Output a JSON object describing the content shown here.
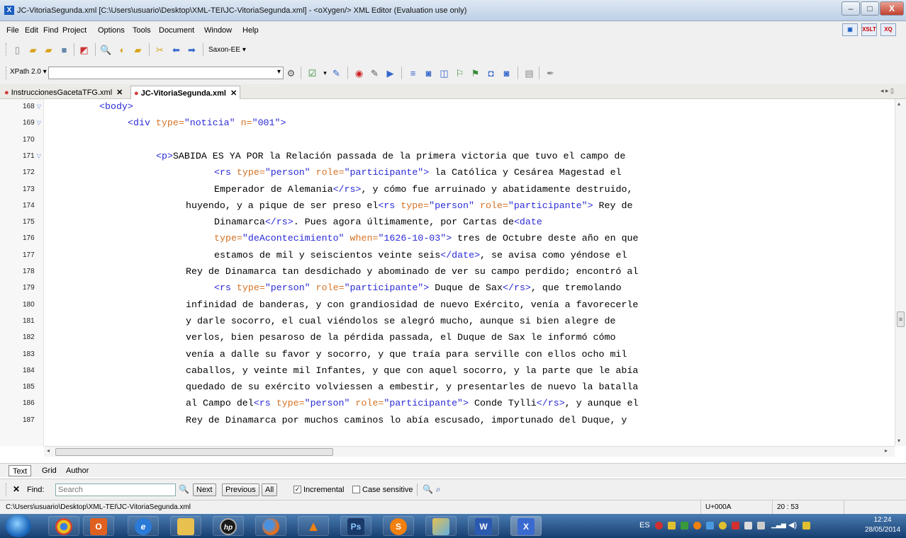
{
  "window": {
    "title": "JC-VitoriaSegunda.xml [C:\\Users\\usuario\\Desktop\\XML-TEI\\JC-VitoriaSegunda.xml] - <oXygen/> XML Editor (Evaluation use only)",
    "controls": {
      "minimize": "–",
      "maximize": "□",
      "close": "X"
    }
  },
  "menu": [
    "File",
    "Edit",
    "Find",
    "Project",
    "Options",
    "Tools",
    "Document",
    "Window",
    "Help"
  ],
  "perspective_buttons": {
    "xslt": "XSLT",
    "xquery": "XQ"
  },
  "toolbar": {
    "transformer": "Saxon-EE",
    "xpath_version": "XPath 2.0",
    "xpath_value": ""
  },
  "tabs": [
    {
      "label": "InstruccionesGacetaTFG.xml",
      "modified": true,
      "active": false
    },
    {
      "label": "JC-VitoriaSegunda.xml",
      "modified": true,
      "active": true
    }
  ],
  "editor": {
    "lines": [
      {
        "n": "168",
        "fold": true,
        "segments": [
          {
            "t": "tag",
            "v": "<body>"
          }
        ]
      },
      {
        "n": "169",
        "fold": true,
        "segments": [
          {
            "t": "tag",
            "v": "<div "
          },
          {
            "t": "attr",
            "v": "type="
          },
          {
            "t": "val",
            "v": "\"noticia\""
          },
          {
            "t": "attr",
            "v": " n="
          },
          {
            "t": "val",
            "v": "\"001\""
          },
          {
            "t": "tag",
            "v": ">"
          }
        ]
      },
      {
        "n": "170",
        "fold": false,
        "segments": []
      },
      {
        "n": "171",
        "fold": true,
        "segments": [
          {
            "t": "tag",
            "v": "<p>"
          },
          {
            "t": "txt",
            "v": "SABIDA ES YA POR la Relación passada de la primera victoria que tuvo el campo de"
          }
        ]
      },
      {
        "n": "172",
        "fold": false,
        "segments": [
          {
            "t": "tag",
            "v": "<rs "
          },
          {
            "t": "attr",
            "v": "type="
          },
          {
            "t": "val",
            "v": "\"person\""
          },
          {
            "t": "attr",
            "v": " role="
          },
          {
            "t": "val",
            "v": "\"participante\""
          },
          {
            "t": "tag",
            "v": ">"
          },
          {
            "t": "txt",
            "v": " la Católica y Cesárea Magestad el"
          }
        ]
      },
      {
        "n": "173",
        "fold": false,
        "segments": [
          {
            "t": "txt",
            "v": "Emperador de Alemania"
          },
          {
            "t": "tag",
            "v": "</rs>"
          },
          {
            "t": "txt",
            "v": ", y cómo fue arruinado y abatidamente destruido,"
          }
        ]
      },
      {
        "n": "174",
        "fold": false,
        "segments": [
          {
            "t": "txt",
            "v": "huyendo, y a pique de ser preso el"
          },
          {
            "t": "tag",
            "v": "<rs "
          },
          {
            "t": "attr",
            "v": "type="
          },
          {
            "t": "val",
            "v": "\"person\""
          },
          {
            "t": "attr",
            "v": " role="
          },
          {
            "t": "val",
            "v": "\"participante\""
          },
          {
            "t": "tag",
            "v": ">"
          },
          {
            "t": "txt",
            "v": " Rey de"
          }
        ]
      },
      {
        "n": "175",
        "fold": false,
        "segments": [
          {
            "t": "txt",
            "v": "Dinamarca"
          },
          {
            "t": "tag",
            "v": "</rs>"
          },
          {
            "t": "txt",
            "v": ". Pues agora últimamente, por Cartas de"
          },
          {
            "t": "tag",
            "v": "<date"
          }
        ]
      },
      {
        "n": "176",
        "fold": false,
        "segments": [
          {
            "t": "attr",
            "v": "type="
          },
          {
            "t": "val",
            "v": "\"deAcontecimiento\""
          },
          {
            "t": "attr",
            "v": " when="
          },
          {
            "t": "val",
            "v": "\"1626-10-03\""
          },
          {
            "t": "tag",
            "v": ">"
          },
          {
            "t": "txt",
            "v": " tres de Octubre deste año en que"
          }
        ]
      },
      {
        "n": "177",
        "fold": false,
        "segments": [
          {
            "t": "txt",
            "v": "estamos de mil y seiscientos veinte seis"
          },
          {
            "t": "tag",
            "v": "</date>"
          },
          {
            "t": "txt",
            "v": ", se avisa como yéndose el"
          }
        ]
      },
      {
        "n": "178",
        "fold": false,
        "segments": [
          {
            "t": "txt",
            "v": "Rey de Dinamarca tan desdichado y abominado de ver su campo perdido; encontró al"
          }
        ]
      },
      {
        "n": "179",
        "fold": false,
        "segments": [
          {
            "t": "tag",
            "v": "<rs "
          },
          {
            "t": "attr",
            "v": "type="
          },
          {
            "t": "val",
            "v": "\"person\""
          },
          {
            "t": "attr",
            "v": " role="
          },
          {
            "t": "val",
            "v": "\"participante\""
          },
          {
            "t": "tag",
            "v": ">"
          },
          {
            "t": "txt",
            "v": " Duque de Sax"
          },
          {
            "t": "tag",
            "v": "</rs>"
          },
          {
            "t": "txt",
            "v": ", que tremolando"
          }
        ]
      },
      {
        "n": "180",
        "fold": false,
        "segments": [
          {
            "t": "txt",
            "v": "infinidad de banderas, y con grandiosidad de nuevo Exército, venía a favorecerle"
          }
        ]
      },
      {
        "n": "181",
        "fold": false,
        "segments": [
          {
            "t": "txt",
            "v": "y darle socorro, el cual viéndolos se alegró mucho, aunque si bien alegre de"
          }
        ]
      },
      {
        "n": "182",
        "fold": false,
        "segments": [
          {
            "t": "txt",
            "v": "verlos, bien pesaroso de la pérdida passada, el Duque de Sax le informó cómo"
          }
        ]
      },
      {
        "n": "183",
        "fold": false,
        "segments": [
          {
            "t": "txt",
            "v": "venía a dalle su favor y socorro, y que traía para serville con ellos ocho mil"
          }
        ]
      },
      {
        "n": "184",
        "fold": false,
        "segments": [
          {
            "t": "txt",
            "v": "caballos, y veinte mil Infantes, y que con aquel socorro, y la parte que le abía"
          }
        ]
      },
      {
        "n": "185",
        "fold": false,
        "segments": [
          {
            "t": "txt",
            "v": "quedado de su exército volviessen a embestir, y presentarles de nuevo la batalla"
          }
        ]
      },
      {
        "n": "186",
        "fold": false,
        "segments": [
          {
            "t": "txt",
            "v": "al Campo del"
          },
          {
            "t": "tag",
            "v": "<rs "
          },
          {
            "t": "attr",
            "v": "type="
          },
          {
            "t": "val",
            "v": "\"person\""
          },
          {
            "t": "attr",
            "v": " role="
          },
          {
            "t": "val",
            "v": "\"participante\""
          },
          {
            "t": "tag",
            "v": ">"
          },
          {
            "t": "txt",
            "v": " Conde Tylli"
          },
          {
            "t": "tag",
            "v": "</rs>"
          },
          {
            "t": "txt",
            "v": ", y aunque el"
          }
        ]
      },
      {
        "n": "187",
        "fold": false,
        "segments": [
          {
            "t": "txt",
            "v": "Rey de Dinamarca por muchos caminos lo abía escusado, importunado del Duque, y"
          }
        ]
      }
    ]
  },
  "editor_modes": [
    "Text",
    "Grid",
    "Author"
  ],
  "find": {
    "label": "Find:",
    "placeholder": "Search",
    "next": "Next",
    "previous": "Previous",
    "all": "All",
    "incremental_label": "Incremental",
    "incremental_checked": true,
    "case_sensitive_label": "Case sensitive",
    "case_sensitive_checked": false
  },
  "status": {
    "path": "C:\\Users\\usuario\\Desktop\\XML-TEI\\JC-VitoriaSegunda.xml",
    "unicode": "U+000A",
    "position": "20 : 53"
  },
  "taskbar": {
    "apps": [
      "chrome",
      "outlook",
      "internet-explorer",
      "file-explorer",
      "hp",
      "firefox",
      "vlc",
      "photoshop",
      "skype",
      "windows-explorer",
      "word",
      "oxygen"
    ],
    "language": "ES",
    "time": "12:24",
    "date": "28/05/2014"
  },
  "colors": {
    "tag": "#2a2ad6",
    "attr": "#d47326",
    "value": "#2a2ad6",
    "modified_dot": "#d03a3a",
    "taskbar": "#2b5a8e"
  }
}
